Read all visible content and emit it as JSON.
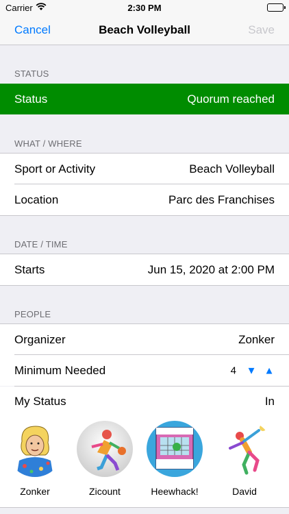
{
  "status_bar": {
    "carrier": "Carrier",
    "time": "2:30 PM"
  },
  "nav": {
    "cancel": "Cancel",
    "title": "Beach Volleyball",
    "save": "Save"
  },
  "sections": {
    "status": "STATUS",
    "what_where": "WHAT / WHERE",
    "date_time": "DATE / TIME",
    "people": "PEOPLE"
  },
  "status_row": {
    "label": "Status",
    "value": "Quorum reached",
    "color": "#008c00"
  },
  "sport": {
    "label": "Sport or Activity",
    "value": "Beach Volleyball"
  },
  "location": {
    "label": "Location",
    "value": "Parc des Franchises"
  },
  "starts": {
    "label": "Starts",
    "value": "Jun 15, 2020 at 2:00 PM"
  },
  "organizer": {
    "label": "Organizer",
    "value": "Zonker"
  },
  "minimum": {
    "label": "Minimum Needed",
    "value": "4"
  },
  "my_status": {
    "label": "My Status",
    "value": "In"
  },
  "people": [
    {
      "name": "Zonker",
      "icon": "cartoon-avatar"
    },
    {
      "name": "Zicount",
      "icon": "basketball-player-avatar"
    },
    {
      "name": "Heewhack!",
      "icon": "album-cover-avatar"
    },
    {
      "name": "David",
      "icon": "volleyball-player-avatar"
    }
  ]
}
